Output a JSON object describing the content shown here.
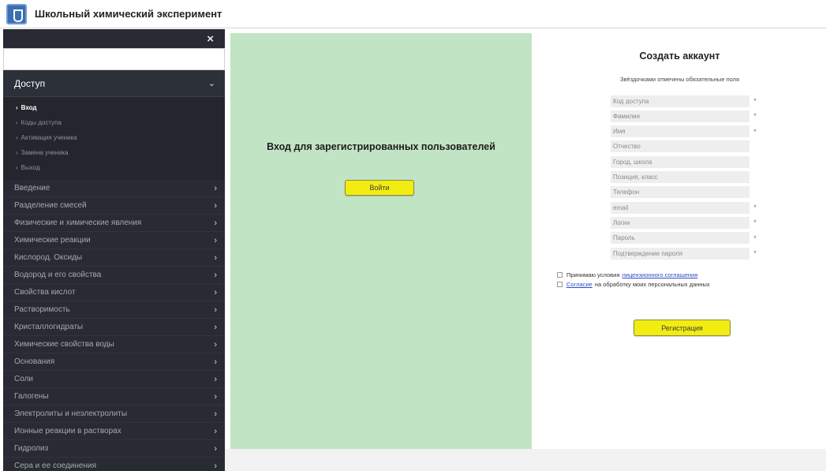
{
  "app": {
    "title": "Школьный химический эксперимент"
  },
  "sidebar": {
    "close_label": "×",
    "search_placeholder": "",
    "section": {
      "label": "Доступ",
      "chevron": "⌄"
    },
    "sub_items": [
      {
        "label": "Вход",
        "active": true
      },
      {
        "label": "Коды доступа",
        "active": false
      },
      {
        "label": "Активация ученика",
        "active": false
      },
      {
        "label": "Замена ученика",
        "active": false
      },
      {
        "label": "Выход",
        "active": false
      }
    ],
    "items": [
      "Введение",
      "Разделение смесей",
      "Физические и химические явления",
      "Химические реакции",
      "Кислород. Оксиды",
      "Водород и его свойства",
      "Свойства кислот",
      "Растворимость",
      "Кристаллогидраты",
      "Химические свойства воды",
      "Основания",
      "Соли",
      "Галогены",
      "Электролиты и неэлектролиты",
      "Ионные реакции в растворах",
      "Гидролиз",
      "Сера и ее соединения"
    ],
    "item_chevron": "›"
  },
  "login": {
    "heading": "Вход для зарегистрированных пользователей",
    "button_label": "Войти"
  },
  "register": {
    "title": "Создать аккаунт",
    "note": "Звёздочками отмечены обязательные поля",
    "fields": [
      {
        "placeholder": "Код доступа",
        "required": "*"
      },
      {
        "placeholder": "Фамилия",
        "required": "*"
      },
      {
        "placeholder": "Имя",
        "required": "*"
      },
      {
        "placeholder": "Отчество",
        "required": ""
      },
      {
        "placeholder": "Город, школа",
        "required": ""
      },
      {
        "placeholder": "Позиция, класс",
        "required": ""
      },
      {
        "placeholder": "Телефон",
        "required": ""
      },
      {
        "placeholder": "email",
        "required": "*"
      },
      {
        "placeholder": "Логин",
        "required": "*"
      },
      {
        "placeholder": "Пароль",
        "required": "*"
      },
      {
        "placeholder": "Подтверждение пароля",
        "required": "*"
      }
    ],
    "consent1": {
      "text": "Принимаю условия",
      "link": "лицензионного соглашения",
      "suffix": ""
    },
    "consent2": {
      "text": "",
      "link": "Согласие",
      "suffix": "на обработку моих персональных данных"
    },
    "button_label": "Регистрация"
  },
  "colors": {
    "sidebar_bg": "#282b33",
    "green_panel": "#c1e4c4",
    "button_yellow": "#f2ec12",
    "link_blue": "#2b4fc4"
  }
}
